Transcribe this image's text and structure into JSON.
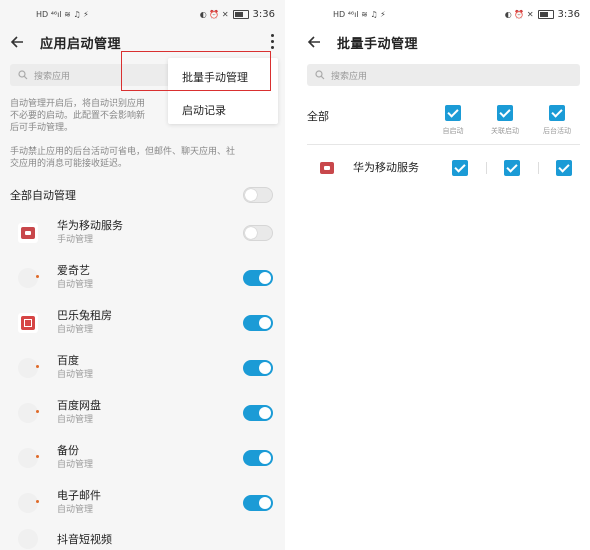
{
  "left": {
    "status": {
      "time": "3:36",
      "left_icons": "HD ⁴⁶ıl ≋ ♫ ⚡",
      "right_icons": "◐ ⏰ ✕"
    },
    "title": "应用启动管理",
    "search_placeholder": "搜索应用",
    "desc1": "自动管理开启后，将自动识别应用\n不必要的启动。此配置不会影响新\n后可手动管理。",
    "desc2": "手动禁止应用的后台活动可省电，但邮件、聊天应用、社\n交应用的消息可能接收延迟。",
    "all_auto_label": "全部自动管理",
    "menu": {
      "item1": "批量手动管理",
      "item2": "启动记录"
    },
    "apps": [
      {
        "name": "华为移动服务",
        "status": "手动管理"
      },
      {
        "name": "爱奇艺",
        "status": "自动管理"
      },
      {
        "name": "巴乐兔租房",
        "status": "自动管理"
      },
      {
        "name": "百度",
        "status": "自动管理"
      },
      {
        "name": "百度网盘",
        "status": "自动管理"
      },
      {
        "name": "备份",
        "status": "自动管理"
      },
      {
        "name": "电子邮件",
        "status": "自动管理"
      },
      {
        "name": "抖音短视频",
        "status": ""
      }
    ],
    "toggles": [
      false,
      false,
      true,
      true,
      true,
      true,
      true,
      true
    ]
  },
  "right": {
    "status": {
      "time": "3:36"
    },
    "title": "批量手动管理",
    "search_placeholder": "搜索应用",
    "all_label": "全部",
    "col_labels": [
      "自启动",
      "关联启动",
      "后台活动"
    ],
    "app": {
      "name": "华为移动服务",
      "checks": [
        true,
        true,
        true
      ]
    }
  },
  "colors": {
    "accent": "#1b9bd6",
    "highlight": "#d93030"
  }
}
